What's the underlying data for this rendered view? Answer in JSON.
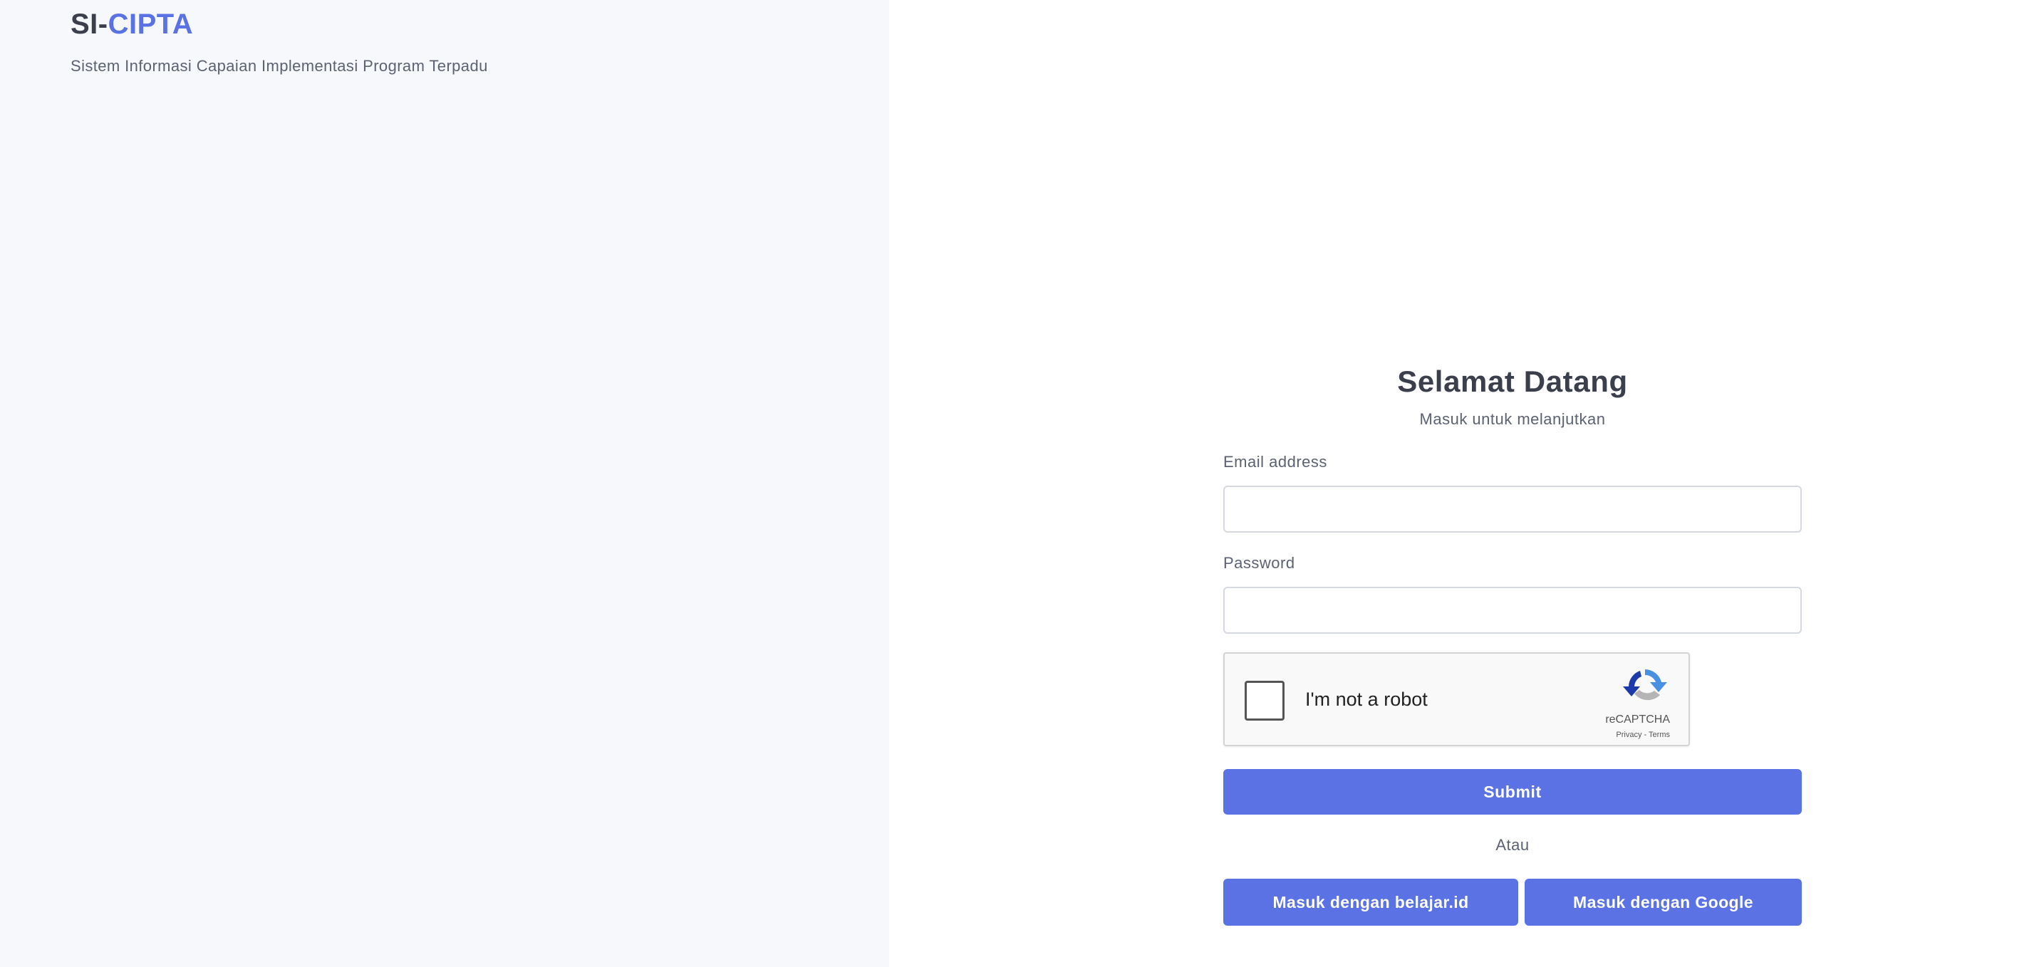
{
  "brand": {
    "prefix": "SI-",
    "accent": "CIPTA",
    "tagline": "Sistem Informasi Capaian Implementasi Program Terpadu"
  },
  "login": {
    "title": "Selamat Datang",
    "subtitle": "Masuk untuk melanjutkan",
    "email_label": "Email address",
    "email_value": "",
    "password_label": "Password",
    "password_value": "",
    "recaptcha": {
      "label": "I'm not a robot",
      "brand": "reCAPTCHA",
      "terms": "Privacy - Terms",
      "checked": false
    },
    "submit_label": "Submit",
    "divider": "Atau",
    "sso_belajar_label": "Masuk dengan belajar.id",
    "sso_google_label": "Masuk dengan Google"
  },
  "colors": {
    "accent": "#5a72e4",
    "left_panel_bg": "#f7f8fc",
    "text_dark": "#3a3f4b",
    "text_muted": "#5c6272"
  }
}
